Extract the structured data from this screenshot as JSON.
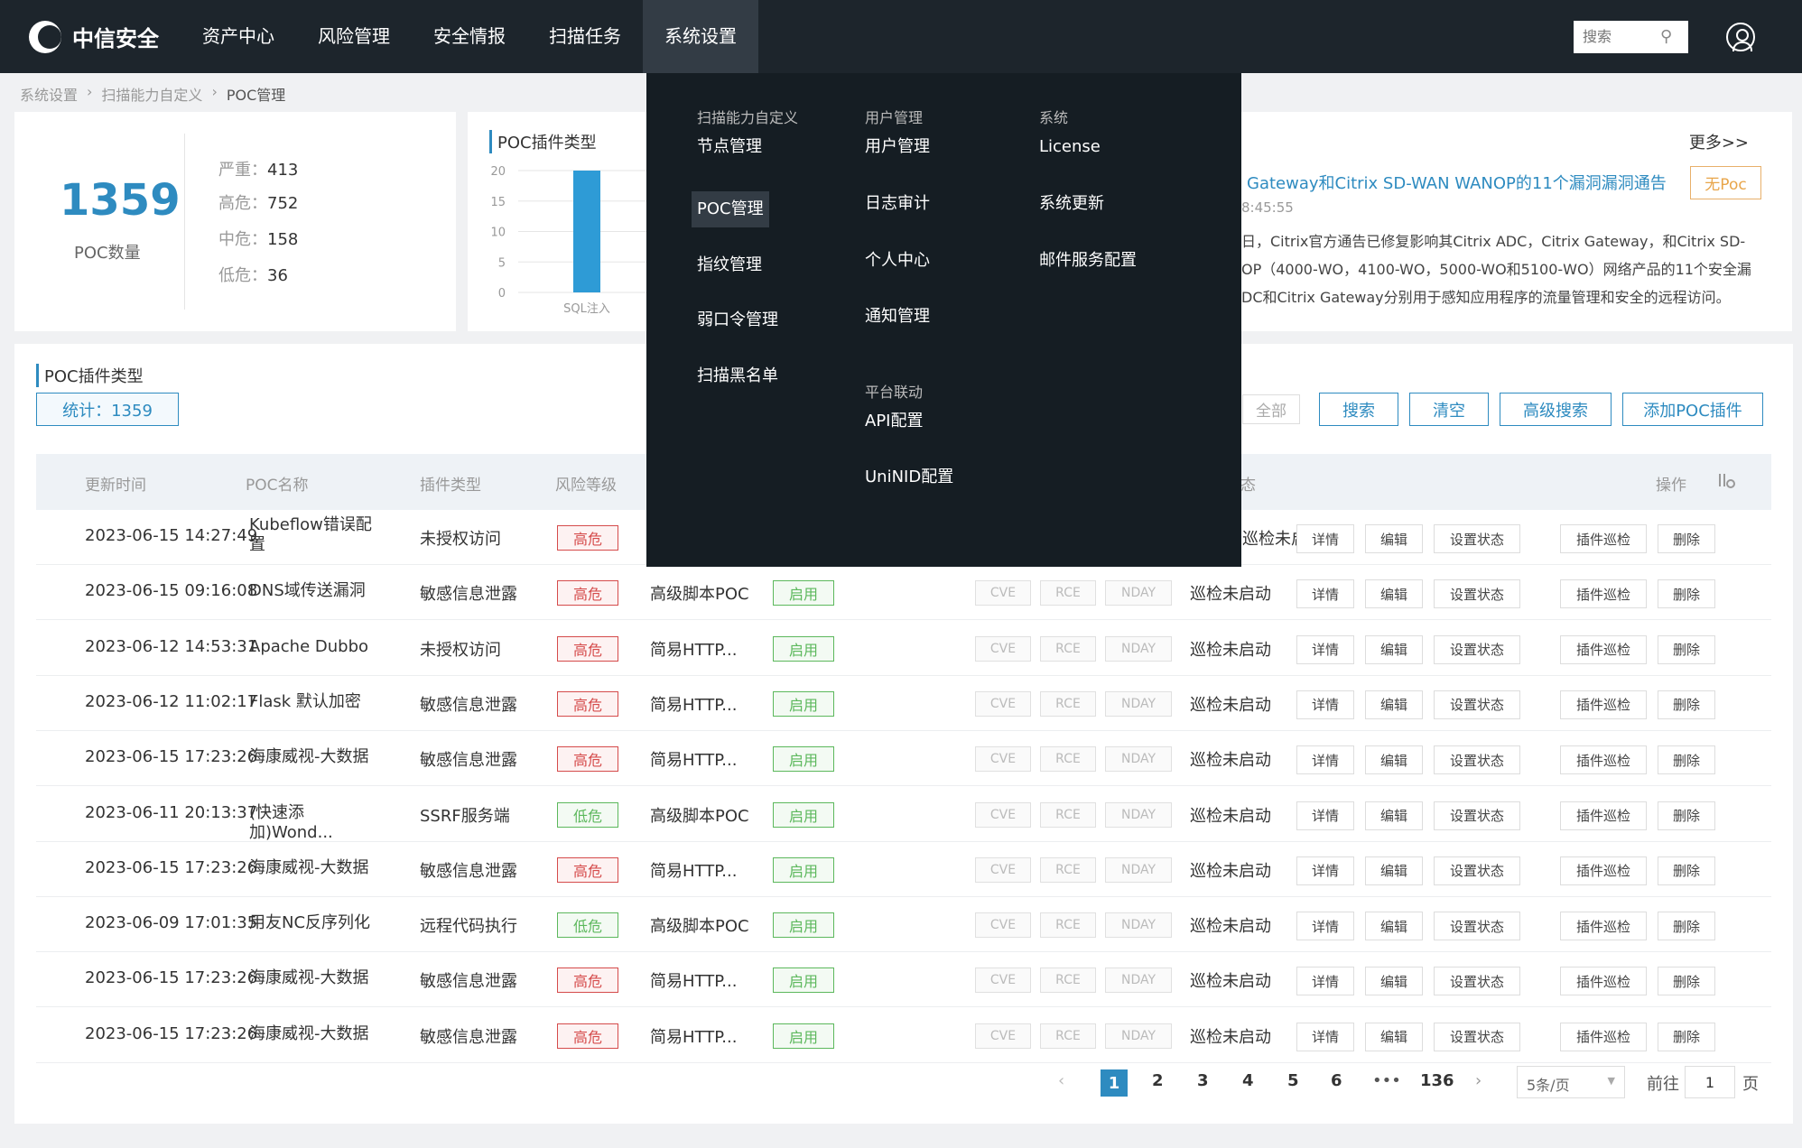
{
  "nav": {
    "logo_text": "中信安全",
    "items": [
      "资产中心",
      "风险管理",
      "安全情报",
      "扫描任务",
      "系统设置"
    ],
    "active_index": 4,
    "search_placeholder": "搜索"
  },
  "breadcrumb": [
    "系统设置",
    "扫描能力自定义",
    "POC管理"
  ],
  "stats": {
    "total": "1359",
    "total_label": "POC数量",
    "levels": [
      {
        "k": "严重：",
        "v": "413"
      },
      {
        "k": "高危：",
        "v": "752"
      },
      {
        "k": "中危：",
        "v": "158"
      },
      {
        "k": "低危：",
        "v": "36"
      }
    ]
  },
  "chart_data": {
    "type": "bar",
    "title": "POC插件类型",
    "categories": [
      "SQL注入"
    ],
    "values": [
      20
    ],
    "yticks": [
      "20",
      "15",
      "10",
      "5",
      "0"
    ],
    "ylim": [
      0,
      20
    ],
    "color": "#2e9bd6"
  },
  "news": {
    "more": "更多>>",
    "title": "Gateway和Citrix SD-WAN WANOP的11个漏洞漏洞通告",
    "time": "8:45:55",
    "body_lines": [
      "日，Citrix官方通告已修复影响其Citrix ADC，Citrix Gateway，和Citrix SD-",
      "OP（4000-WO，4100-WO，5000-WO和5100-WO）网络产品的11个安全漏",
      "DC和Citrix Gateway分别用于感知应用程序的流量管理和安全的远程访问。"
    ],
    "tag": "无Poc"
  },
  "table_section": {
    "title": "POC插件类型",
    "count": "统计：1359",
    "all_btn": "全部",
    "buttons": [
      "搜索",
      "清空",
      "高级搜索",
      "添加POC插件"
    ],
    "headers": [
      "更新时间",
      "POC名称",
      "插件类型",
      "风险等级",
      "态",
      "操作"
    ]
  },
  "rows": [
    {
      "time": "2023-06-15 14:27:49",
      "name": "Kubeflow错误配置",
      "ptype": "未授权访问",
      "risk": "高危",
      "tool": "",
      "status": "",
      "tags": [
        "",
        "",
        ""
      ],
      "patrol": "巡检未启动"
    },
    {
      "time": "2023-06-15 09:16:08",
      "name": "DNS域传送漏洞",
      "ptype": "敏感信息泄露",
      "risk": "高危",
      "tool": "高级脚本POC",
      "status": "启用",
      "tags": [
        "CVE",
        "RCE",
        "NDAY"
      ],
      "patrol": "巡检未启动"
    },
    {
      "time": "2023-06-12 14:53:31",
      "name": "Apache Dubbo",
      "ptype": "未授权访问",
      "risk": "高危",
      "tool": "简易HTTP...",
      "status": "启用",
      "tags": [
        "CVE",
        "RCE",
        "NDAY"
      ],
      "patrol": "巡检未启动"
    },
    {
      "time": "2023-06-12 11:02:17",
      "name": "Flask 默认加密",
      "ptype": "敏感信息泄露",
      "risk": "高危",
      "tool": "简易HTTP...",
      "status": "启用",
      "tags": [
        "CVE",
        "RCE",
        "NDAY"
      ],
      "patrol": "巡检未启动"
    },
    {
      "time": "2023-06-15 17:23:26",
      "name": "海康威视-大数据",
      "ptype": "敏感信息泄露",
      "risk": "高危",
      "tool": "简易HTTP...",
      "status": "启用",
      "tags": [
        "CVE",
        "RCE",
        "NDAY"
      ],
      "patrol": "巡检未启动"
    },
    {
      "time": "2023-06-11 20:13:37",
      "name": "(快速添加)Wond...",
      "ptype": "SSRF服务端",
      "risk": "低危",
      "tool": "高级脚本POC",
      "status": "启用",
      "tags": [
        "CVE",
        "RCE",
        "NDAY"
      ],
      "patrol": "巡检未启动"
    },
    {
      "time": "2023-06-15 17:23:26",
      "name": "海康威视-大数据",
      "ptype": "敏感信息泄露",
      "risk": "高危",
      "tool": "简易HTTP...",
      "status": "启用",
      "tags": [
        "CVE",
        "RCE",
        "NDAY"
      ],
      "patrol": "巡检未启动"
    },
    {
      "time": "2023-06-09 17:01:35",
      "name": "用友NC反序列化",
      "ptype": "远程代码执行",
      "risk": "低危",
      "tool": "高级脚本POC",
      "status": "启用",
      "tags": [
        "CVE",
        "RCE",
        "NDAY"
      ],
      "patrol": "巡检未启动"
    },
    {
      "time": "2023-06-15 17:23:26",
      "name": "海康威视-大数据",
      "ptype": "敏感信息泄露",
      "risk": "高危",
      "tool": "简易HTTP...",
      "status": "启用",
      "tags": [
        "CVE",
        "RCE",
        "NDAY"
      ],
      "patrol": "巡检未启动"
    },
    {
      "time": "2023-06-15 17:23:26",
      "name": "海康威视-大数据",
      "ptype": "敏感信息泄露",
      "risk": "高危",
      "tool": "简易HTTP...",
      "status": "启用",
      "tags": [
        "CVE",
        "RCE",
        "NDAY"
      ],
      "patrol": "巡检未启动"
    }
  ],
  "actions": [
    "详情",
    "编辑",
    "设置状态",
    "插件巡检",
    "删除"
  ],
  "pager": {
    "pages": [
      "1",
      "2",
      "3",
      "4",
      "5",
      "6"
    ],
    "ellipsis": "•••",
    "last": "136",
    "prev": "‹",
    "next": "›",
    "size": "5条/页",
    "goto": "前往",
    "page_value": "1",
    "page_unit": "页"
  },
  "dropdown": {
    "columns": [
      {
        "head": "扫描能力自定义",
        "items": [
          "节点管理",
          "POC管理",
          "指纹管理",
          "弱口令管理",
          "扫描黑名单"
        ]
      },
      {
        "head": "用户管理",
        "items": [
          "用户管理",
          "日志审计",
          "个人中心",
          "通知管理"
        ]
      },
      {
        "head": "系统",
        "items": [
          "License",
          "系统更新",
          "邮件服务配置"
        ]
      },
      {
        "head": "平台联动",
        "items": [
          "API配置",
          "UniNID配置"
        ]
      }
    ],
    "active_item": "POC管理"
  }
}
